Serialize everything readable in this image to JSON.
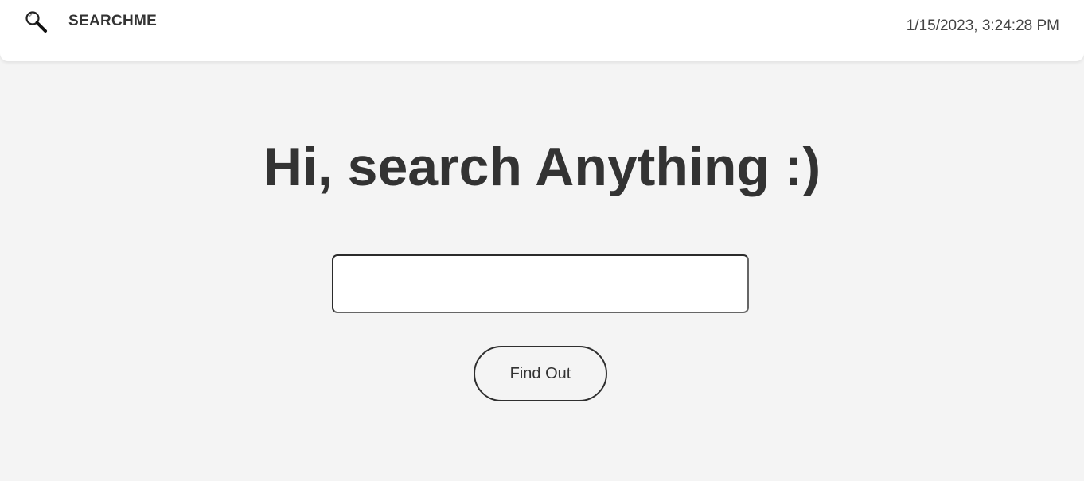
{
  "header": {
    "brand": "SEARCHME",
    "logo_icon": "magnifier-icon",
    "datetime": "1/15/2023, 3:24:28 PM"
  },
  "main": {
    "heading": "Hi, search Anything :)",
    "search_input": {
      "value": "",
      "placeholder": ""
    },
    "find_button_label": "Find Out"
  },
  "colors": {
    "page_background": "#f4f4f4",
    "header_background": "#ffffff",
    "text": "#333333"
  }
}
